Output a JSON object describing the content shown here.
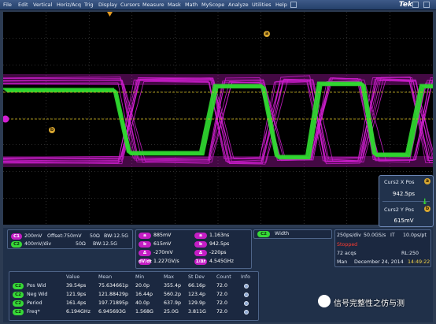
{
  "menu": [
    "File",
    "Edit",
    "Vertical",
    "Horiz/Acq",
    "Trig",
    "Display",
    "Cursors",
    "Measure",
    "Mask",
    "Math",
    "MyScope",
    "Analyze",
    "Utilities",
    "Help"
  ],
  "brand": "Tek",
  "markers": {
    "cursor_a": "a",
    "cursor_b": "b"
  },
  "cursor_readout": {
    "x_label": "Curs2 X Pos",
    "x_value": "942.5ps",
    "y_label": "Curs2 Y Pos",
    "y_value": "615mV",
    "x_badge": "a",
    "y_badge": "b"
  },
  "channels": [
    {
      "chip": "C1",
      "scale": "200mV",
      "offset": "Offset:750mV",
      "impedance": "50Ω",
      "bw": "BW:12.5G"
    },
    {
      "chip": "C2",
      "scale": "400mV/div",
      "offset": "",
      "impedance": "50Ω",
      "bw": "BW:12.5G"
    }
  ],
  "cursor_values": {
    "left": [
      {
        "chip": "a",
        "value": "885mV"
      },
      {
        "chip": "b",
        "value": "615mV"
      },
      {
        "chip": "Δ",
        "value": "-270mV"
      },
      {
        "chip": "dV/dt",
        "value": "1.227GV/s"
      }
    ],
    "right": [
      {
        "chip": "a",
        "value": "1.163ns"
      },
      {
        "chip": "b",
        "value": "942.5ps"
      },
      {
        "chip": "Δ",
        "value": "-220ps"
      },
      {
        "chip": "1/Δt",
        "value": "4.545GHz"
      }
    ]
  },
  "width_panel": {
    "chip": "C2",
    "label": "Width"
  },
  "acquisition": {
    "timebase": "250ps/div",
    "rate": "50.0GS/s",
    "it": "IT",
    "resolution": "10.0ps/pt",
    "state": "Stopped",
    "acqs": "72 acqs",
    "record_length": "RL:250",
    "mode": "Man",
    "date": "December 24, 2014",
    "time": "14:49:22"
  },
  "measurements": {
    "headers": [
      "Value",
      "Mean",
      "Min",
      "Max",
      "St Dev",
      "Count",
      "Info"
    ],
    "rows": [
      {
        "chip": "C2",
        "name": "Pos Wid",
        "value": "39.54ps",
        "mean": "75.634661p",
        "min": "20.0p",
        "max": "355.4p",
        "stdev": "66.16p",
        "count": "72.0"
      },
      {
        "chip": "C2",
        "name": "Neg Wid",
        "value": "121.9ps",
        "mean": "121.88429p",
        "min": "16.44p",
        "max": "560.2p",
        "stdev": "123.4p",
        "count": "72.0"
      },
      {
        "chip": "C2",
        "name": "Period",
        "value": "161.4ps",
        "mean": "197.71895p",
        "min": "40.0p",
        "max": "637.9p",
        "stdev": "129.9p",
        "count": "72.0"
      },
      {
        "chip": "C2",
        "name": "Freq*",
        "value": "6.194GHz",
        "mean": "6.945693G",
        "min": "1.568G",
        "max": "25.0G",
        "stdev": "3.811G",
        "count": "72.0"
      }
    ]
  },
  "watermark": "信号完整性之仿与测",
  "colors": {
    "ch1": "#d21fd2",
    "ch2": "#30d930",
    "graticule": "#7a7a7a"
  }
}
